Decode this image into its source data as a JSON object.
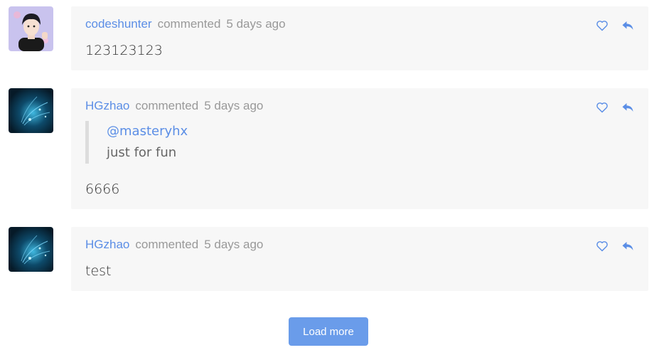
{
  "comments": [
    {
      "author": "codeshunter",
      "action": "commented",
      "time": "5 days ago",
      "body": "123123123",
      "avatar": "anime-boy-avatar"
    },
    {
      "author": "HGzhao",
      "action": "commented",
      "time": "5 days ago",
      "quote": {
        "mention": "@masteryhx",
        "text": "just for fun"
      },
      "body": "6666",
      "avatar": "blue-light-avatar"
    },
    {
      "author": "HGzhao",
      "action": "commented",
      "time": "5 days ago",
      "body": "test",
      "avatar": "blue-light-avatar"
    }
  ],
  "icons": {
    "like": "heart-icon",
    "reply": "reply-icon"
  },
  "colors": {
    "link": "#5b8ee6",
    "muted": "#999999",
    "card_bg": "#f7f7f7",
    "button_bg": "#6a9cea"
  },
  "load_more_label": "Load more"
}
